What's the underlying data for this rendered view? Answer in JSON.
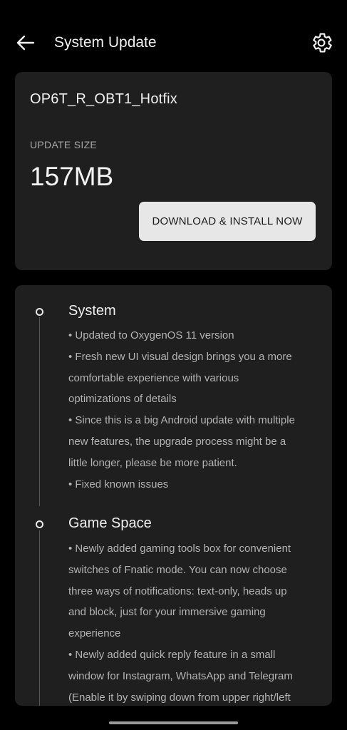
{
  "header": {
    "title": "System Update"
  },
  "update": {
    "package_name": "OP6T_R_OBT1_Hotfix",
    "size_label": "UPDATE SIZE",
    "size_value": "157MB",
    "button_label": "DOWNLOAD & INSTALL NOW"
  },
  "sections": [
    {
      "title": "System",
      "lines": [
        "• Updated to OxygenOS 11 version",
        "• Fresh new UI visual design brings you a more",
        "comfortable experience with various",
        "optimizations of details",
        "• Since this is a big Android update with multiple",
        "new features, the upgrade process might be a",
        "little longer, please be more patient.",
        "• Fixed known issues"
      ]
    },
    {
      "title": "Game Space",
      "lines": [
        "• Newly added gaming tools box for convenient",
        "switches of Fnatic mode. You can now choose",
        "three ways of notifications: text-only, heads up",
        "and block, just for your immersive gaming",
        "experience",
        "• Newly added quick reply feature in a small",
        "window for Instagram, WhatsApp and Telegram",
        "(Enable it by swiping down from upper right/left"
      ]
    }
  ],
  "colors": {
    "background": "#000000",
    "card": "#1f1f1f",
    "button": "#e7e7e7"
  }
}
